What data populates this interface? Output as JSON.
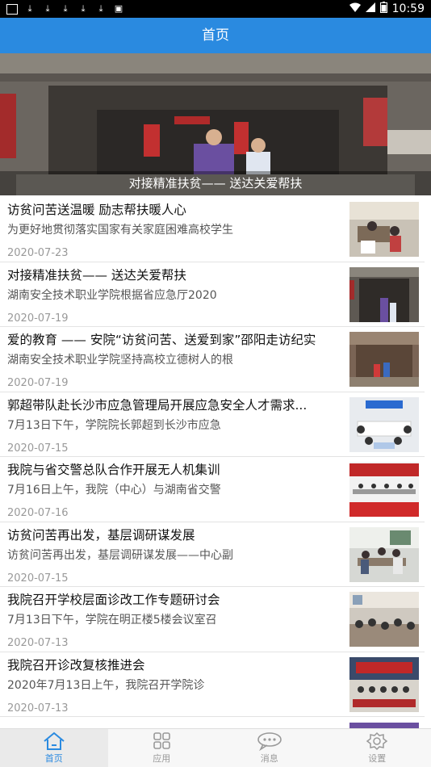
{
  "statusbar": {
    "time": "10:59"
  },
  "header": {
    "title": "首页"
  },
  "banner": {
    "caption": "对接精准扶贫—— 送达关爱帮扶"
  },
  "news": [
    {
      "title": "访贫问苦送温暖 励志帮扶暖人心",
      "summary": "为更好地贯彻落实国家有关家庭困难高校学生",
      "date": "2020-07-23"
    },
    {
      "title": "对接精准扶贫—— 送达关爱帮扶",
      "summary": "湖南安全技术职业学院根据省应急厅2020",
      "date": "2020-07-19"
    },
    {
      "title": "爱的教育 —— 安院“访贫问苦、送爱到家”邵阳走访纪实",
      "summary": "湖南安全技术职业学院坚持高校立德树人的根",
      "date": "2020-07-19"
    },
    {
      "title": "郭超带队赴长沙市应急管理局开展应急安全人才需求...",
      "summary": "7月13日下午，学院院长郭超到长沙市应急",
      "date": "2020-07-15"
    },
    {
      "title": "我院与省交警总队合作开展无人机集训",
      "summary": "7月16日上午，我院（中心）与湖南省交警",
      "date": "2020-07-16"
    },
    {
      "title": "访贫问苦再出发，基层调研谋发展",
      "summary": "访贫问苦再出发，基层调研谋发展——中心副",
      "date": "2020-07-15"
    },
    {
      "title": "我院召开学校层面诊改工作专题研讨会",
      "summary": "7月13日下午，学院在明正楼5楼会议室召",
      "date": "2020-07-13"
    },
    {
      "title": "我院召开诊改复核推进会",
      "summary": "2020年7月13日上午，我院召开学院诊",
      "date": "2020-07-13"
    }
  ],
  "tabbar": {
    "home": "首页",
    "apps": "应用",
    "messages": "消息",
    "settings": "设置"
  },
  "colors": {
    "accent": "#2a8ae0"
  }
}
